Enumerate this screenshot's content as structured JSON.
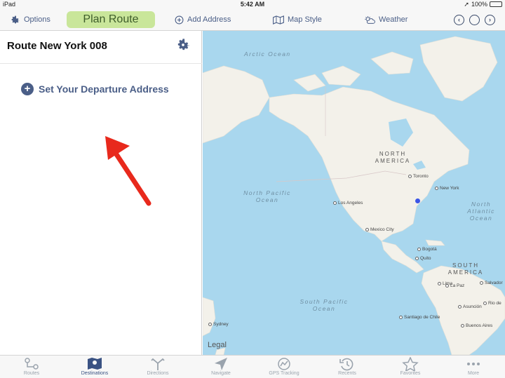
{
  "status": {
    "device": "iPad",
    "time": "5:42 AM",
    "battery": "100%"
  },
  "toolbar": {
    "options_label": "Options",
    "plan_route_label": "Plan Route",
    "add_address_label": "Add Address",
    "map_style_label": "Map Style",
    "weather_label": "Weather",
    "colors": {
      "accent": "#4a5e87",
      "plan_route_bg": "#c9e69a"
    }
  },
  "panel": {
    "route_title": "Route New York 008",
    "set_departure_label": "Set Your Departure Address",
    "arrow_color": "#e8291c"
  },
  "map": {
    "ocean_labels": [
      "Arctic Ocean",
      "North Pacific Ocean",
      "North Atlantic Ocean",
      "South Pacific Ocean"
    ],
    "continent_labels": [
      "NORTH AMERICA",
      "SOUTH AMERICA"
    ],
    "cities": [
      "Toronto",
      "New York",
      "Los Angeles",
      "Mexico City",
      "Bogotá",
      "Quito",
      "Lima",
      "La Paz",
      "Salvador",
      "Asunción",
      "Rio de",
      "Santiago de Chile",
      "Buenos Aires",
      "Sydney"
    ],
    "legal_label": "Legal",
    "location_dot_color": "#3b55e6"
  },
  "tabs": [
    {
      "label": "Routes",
      "icon": "routes-icon",
      "active": false
    },
    {
      "label": "Destinations",
      "icon": "map-pin-icon",
      "active": true
    },
    {
      "label": "Directions",
      "icon": "directions-icon",
      "active": false
    },
    {
      "label": "Navigate",
      "icon": "navigate-arrow-icon",
      "active": false
    },
    {
      "label": "GPS Tracking",
      "icon": "gps-icon",
      "active": false
    },
    {
      "label": "Recents",
      "icon": "history-icon",
      "active": false
    },
    {
      "label": "Favorites",
      "icon": "star-icon",
      "active": false
    },
    {
      "label": "More",
      "icon": "more-dots-icon",
      "active": false
    }
  ]
}
